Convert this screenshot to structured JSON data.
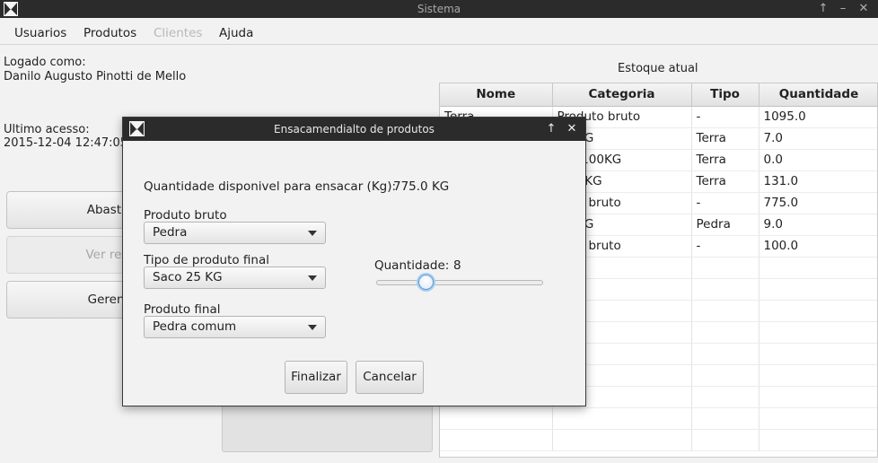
{
  "window": {
    "title": "Sistema",
    "icon": "app-logo-icon"
  },
  "menu": {
    "items": [
      {
        "label": "Usuarios",
        "enabled": true
      },
      {
        "label": "Produtos",
        "enabled": true
      },
      {
        "label": "Clientes",
        "enabled": false
      },
      {
        "label": "Ajuda",
        "enabled": true
      }
    ]
  },
  "session": {
    "logged_as_label": "Logado como:",
    "user_name": "Danilo Augusto Pinotti de Mello",
    "last_access_label": "Ultimo acesso:",
    "last_access_value": "2015-12-04 12:47:05"
  },
  "actions": {
    "stock_button": "Abastecer e",
    "reports_button": "Ver relatorio",
    "manage_button": "Gerenciar u"
  },
  "stock": {
    "title": "Estoque atual",
    "columns": [
      "Nome",
      "Categoria",
      "Tipo",
      "Quantidade"
    ],
    "rows": [
      [
        "Terra",
        "Produto bruto",
        "-",
        "1095.0"
      ],
      [
        "",
        "50 KG",
        "Terra",
        "7.0"
      ],
      [
        "",
        "por 100KG",
        "Terra",
        "0.0"
      ],
      [
        "",
        "te 5 KG",
        "Terra",
        "131.0"
      ],
      [
        "",
        "duto bruto",
        "-",
        "775.0"
      ],
      [
        "",
        "25 KG",
        "Pedra",
        "9.0"
      ],
      [
        "",
        "duto bruto",
        "-",
        "100.0"
      ]
    ]
  },
  "dialog": {
    "title": "Ensacamendialto de produtos",
    "available_label": "Quantidade disponivel para ensacar (Kg):",
    "available_value": "775.0 KG",
    "raw_product_label": "Produto bruto",
    "raw_product_value": "Pedra",
    "final_type_label": "Tipo de produto final",
    "final_type_value": "Saco 25 KG",
    "final_product_label": "Produto final",
    "final_product_value": "Pedra comum",
    "quantity_label": "Quantidade:",
    "quantity_value": "8",
    "slider_fraction": 0.3,
    "finish_button": "Finalizar",
    "cancel_button": "Cancelar"
  },
  "colors": {
    "titlebar": "#2b2b2b",
    "slider_focus": "#a7cdf0"
  }
}
